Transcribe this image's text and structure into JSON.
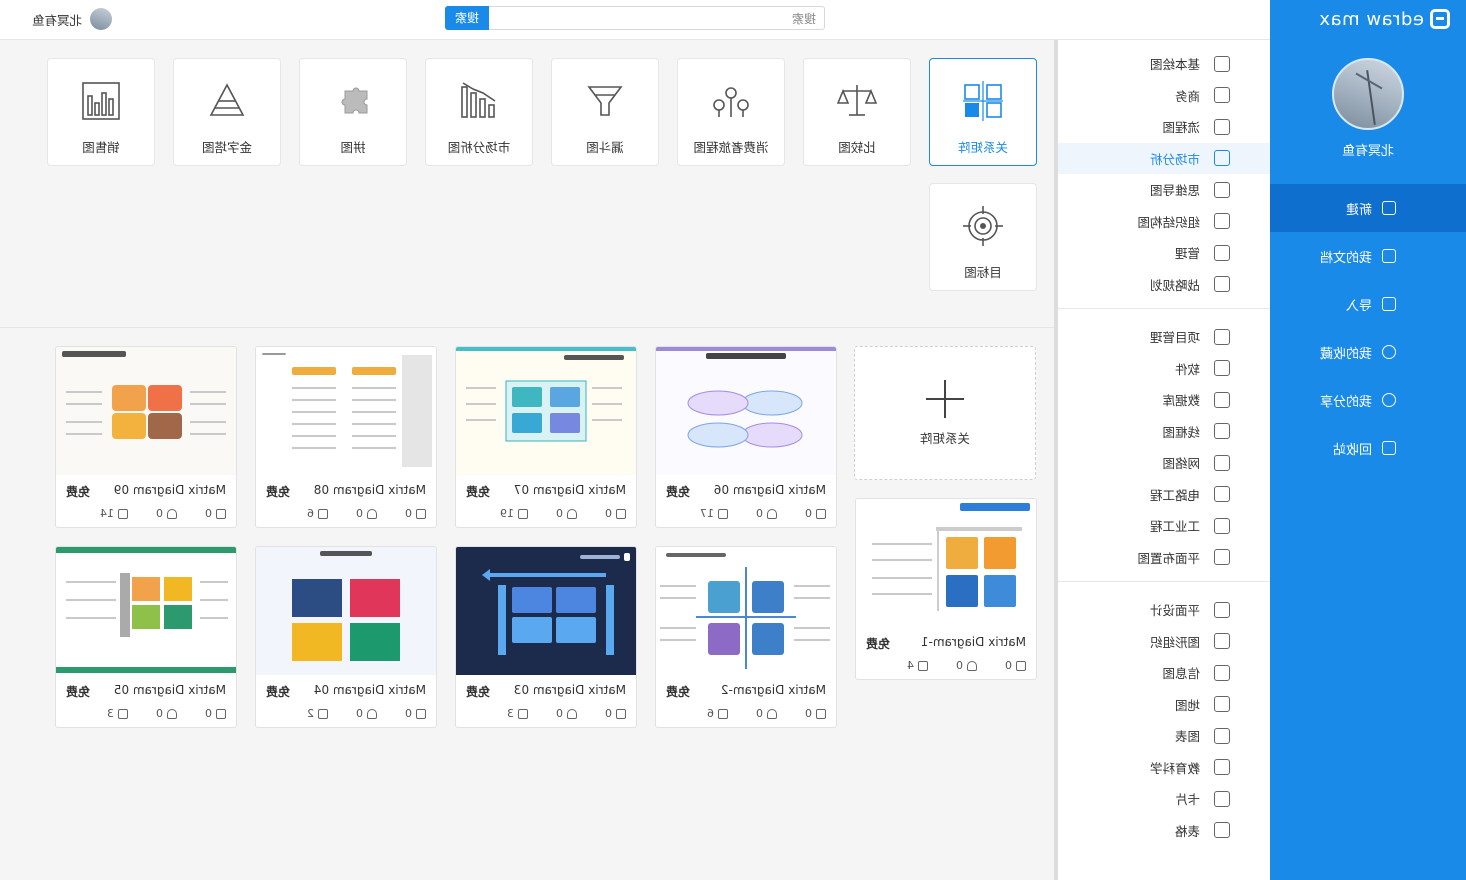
{
  "app": {
    "logo_text": "edraw max"
  },
  "user": {
    "name": "北冥有鱼"
  },
  "search": {
    "placeholder": "搜索",
    "button": "搜索"
  },
  "nav": {
    "items": [
      {
        "label": "新建",
        "icon": "new-file-icon",
        "active": true
      },
      {
        "label": "我的文档",
        "icon": "documents-icon"
      },
      {
        "label": "导入",
        "icon": "import-icon"
      },
      {
        "label": "我的收藏",
        "icon": "star-icon"
      },
      {
        "label": "我的分享",
        "icon": "share-icon"
      },
      {
        "label": "回收站",
        "icon": "trash-icon"
      }
    ]
  },
  "categories": {
    "group1": [
      {
        "label": "基本绘图",
        "icon": "shapes-icon"
      },
      {
        "label": "商务",
        "icon": "briefcase-icon"
      },
      {
        "label": "流程图",
        "icon": "flowchart-icon"
      },
      {
        "label": "市场分析",
        "icon": "bar-chart-icon",
        "active": true
      },
      {
        "label": "思维导图",
        "icon": "mindmap-icon"
      },
      {
        "label": "组织结构图",
        "icon": "org-chart-icon"
      },
      {
        "label": "管理",
        "icon": "gear-people-icon"
      },
      {
        "label": "战略规划",
        "icon": "strategy-icon"
      }
    ],
    "group2": [
      {
        "label": "项目管理",
        "icon": "gantt-icon"
      },
      {
        "label": "软件",
        "icon": "software-icon"
      },
      {
        "label": "数据库",
        "icon": "database-icon"
      },
      {
        "label": "线框图",
        "icon": "wireframe-icon"
      },
      {
        "label": "网络图",
        "icon": "network-icon"
      },
      {
        "label": "电路工程",
        "icon": "circuit-icon"
      },
      {
        "label": "工业工程",
        "icon": "industry-icon"
      },
      {
        "label": "平面布置图",
        "icon": "floorplan-icon"
      }
    ],
    "group3": [
      {
        "label": "平面设计",
        "icon": "design-icon"
      },
      {
        "label": "图形组织",
        "icon": "graphic-organizer-icon"
      },
      {
        "label": "信息图",
        "icon": "infographic-icon"
      },
      {
        "label": "地图",
        "icon": "map-pin-icon"
      },
      {
        "label": "图表",
        "icon": "chart-icon"
      },
      {
        "label": "教育科学",
        "icon": "atom-icon"
      },
      {
        "label": "卡片",
        "icon": "card-icon"
      },
      {
        "label": "表格",
        "icon": "table-icon"
      }
    ]
  },
  "types": [
    {
      "label": "关系矩阵",
      "icon": "matrix-icon",
      "active": true
    },
    {
      "label": "比较图",
      "icon": "balance-icon"
    },
    {
      "label": "消费者旅程图",
      "icon": "journey-icon"
    },
    {
      "label": "漏斗图",
      "icon": "funnel-icon"
    },
    {
      "label": "市场分析图",
      "icon": "growth-chart-icon"
    },
    {
      "label": "拼图",
      "icon": "puzzle-icon"
    },
    {
      "label": "金字塔图",
      "icon": "pyramid-icon"
    },
    {
      "label": "销售图",
      "icon": "sales-bar-icon"
    },
    {
      "label": "目标图",
      "icon": "target-icon"
    }
  ],
  "new_template": {
    "label": "关系矩阵"
  },
  "templates": [
    {
      "title": "Matrix Diagram-1",
      "badge": "免费",
      "likes": "0",
      "favs": "0",
      "copies": "4",
      "theme": "blue-orange"
    },
    {
      "title": "Matrix Diagram 06",
      "badge": "免费",
      "likes": "0",
      "favs": "0",
      "copies": "17",
      "theme": "purple-oval"
    },
    {
      "title": "Matrix Diagram 07",
      "badge": "免费",
      "likes": "0",
      "favs": "0",
      "copies": "19",
      "theme": "teal-grid"
    },
    {
      "title": "Matrix Diagram 08",
      "badge": "免费",
      "likes": "0",
      "favs": "0",
      "copies": "6",
      "theme": "orange-text"
    },
    {
      "title": "Matrix Diagram 09",
      "badge": "免费",
      "likes": "0",
      "favs": "0",
      "copies": "14",
      "theme": "puzzle-color"
    },
    {
      "title": "Matrix Diagram-2",
      "badge": "免费",
      "likes": "0",
      "favs": "0",
      "copies": "6",
      "theme": "quadrant"
    },
    {
      "title": "Matrix Diagram 03",
      "badge": "免费",
      "likes": "0",
      "favs": "0",
      "copies": "3",
      "theme": "dark-navy"
    },
    {
      "title": "Matrix Diagram 04",
      "badge": "免费",
      "likes": "0",
      "favs": "0",
      "copies": "2",
      "theme": "four-color"
    },
    {
      "title": "Matrix Diagram 05",
      "badge": "免费",
      "likes": "0",
      "favs": "0",
      "copies": "3",
      "theme": "green-grid"
    }
  ],
  "colors": {
    "accent": "#1a8ae8",
    "nav_bg": "#1a8ae8",
    "nav_active": "#0f6fcf"
  }
}
